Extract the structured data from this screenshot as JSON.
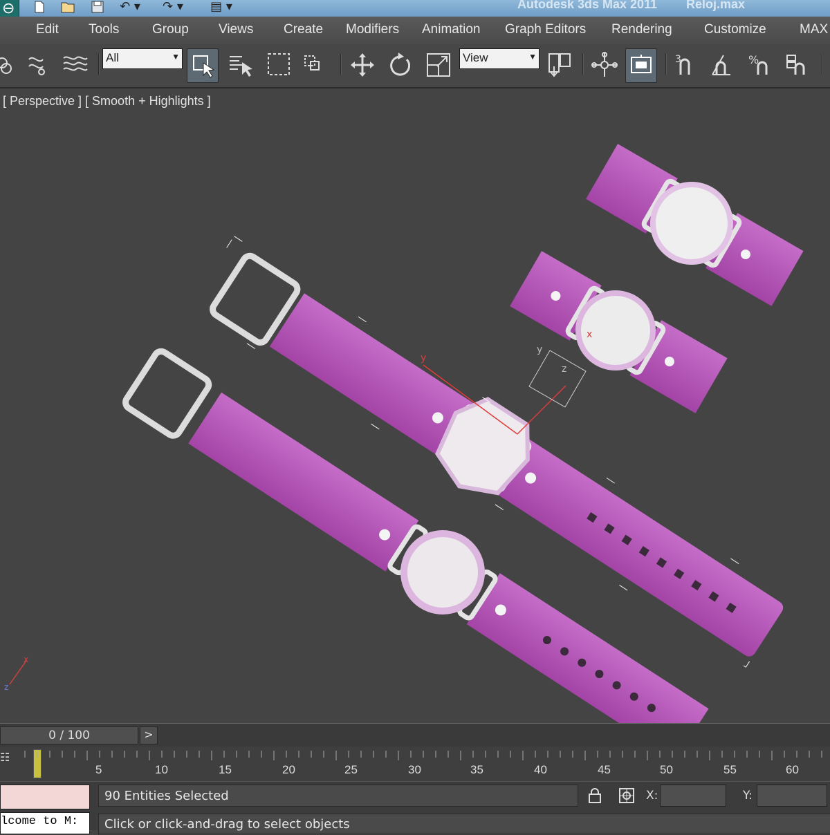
{
  "titlebar": {
    "app_title": "Autodesk 3ds Max 2011",
    "file_name": "Reloj.max",
    "app_icon_glyph": "⊖"
  },
  "menu": [
    {
      "id": "edit",
      "label": "Edit"
    },
    {
      "id": "tools",
      "label": "Tools"
    },
    {
      "id": "group",
      "label": "Group"
    },
    {
      "id": "views",
      "label": "Views"
    },
    {
      "id": "create",
      "label": "Create"
    },
    {
      "id": "modifiers",
      "label": "Modifiers"
    },
    {
      "id": "animation",
      "label": "Animation"
    },
    {
      "id": "graph-editors",
      "label": "Graph Editors"
    },
    {
      "id": "rendering",
      "label": "Rendering"
    },
    {
      "id": "customize",
      "label": "Customize"
    },
    {
      "id": "maxscript",
      "label": "MAX"
    }
  ],
  "toolbar": {
    "selection_filter": "All",
    "ref_coord_system": "View"
  },
  "viewport": {
    "label": "[ Perspective ] [ Smooth + Highlights ]",
    "strap_color": "#b24fb5",
    "axis_x": "x",
    "axis_y": "y",
    "axis_z": "z"
  },
  "timeline": {
    "frame_display": "0 / 100",
    "next_label": ">",
    "ticks": [
      "5",
      "10",
      "15",
      "20",
      "25",
      "30",
      "35",
      "40",
      "45",
      "50",
      "55",
      "60"
    ]
  },
  "status": {
    "listener_text": "lcome to M:",
    "selection_status": "90 Entities Selected",
    "prompt": "Click or click-and-drag to select objects",
    "x_label": "X:",
    "y_label": "Y:"
  }
}
